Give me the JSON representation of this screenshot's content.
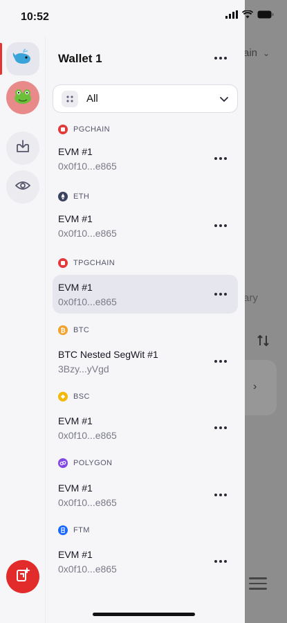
{
  "status_bar": {
    "time": "10:52"
  },
  "background_page": {
    "chain_label": "ain",
    "tab_fragment": "ary"
  },
  "wallet": {
    "title": "Wallet 1",
    "filter": {
      "selected": "All"
    }
  },
  "accounts": [
    {
      "network": "PGCHAIN",
      "network_color": "#e23a3a",
      "name": "EVM #1",
      "address": "0x0f10...e865",
      "selected": false
    },
    {
      "network": "ETH",
      "network_color": "#3a4260",
      "name": "EVM #1",
      "address": "0x0f10...e865",
      "selected": false
    },
    {
      "network": "TPGCHAIN",
      "network_color": "#e23a3a",
      "name": "EVM #1",
      "address": "0x0f10...e865",
      "selected": true
    },
    {
      "network": "BTC",
      "network_color": "#f0a22a",
      "name": "BTC Nested SegWit #1",
      "address": "3Bzy...yVgd",
      "selected": false
    },
    {
      "network": "BSC",
      "network_color": "#f0b90b",
      "name": "EVM #1",
      "address": "0x0f10...e865",
      "selected": false
    },
    {
      "network": "POLYGON",
      "network_color": "#8247e5",
      "name": "EVM #1",
      "address": "0x0f10...e865",
      "selected": false
    },
    {
      "network": "FTM",
      "network_color": "#1969ff",
      "name": "EVM #1",
      "address": "0x0f10...e865",
      "selected": false
    }
  ],
  "icons": {
    "wallet1": "whale-avatar-icon",
    "wallet2": "frog-avatar-icon",
    "import": "import-icon",
    "watch": "eye-icon",
    "add": "add-wallet-icon"
  },
  "colors": {
    "accent": "#e22b2b",
    "selected_row": "#e6e6ef"
  }
}
